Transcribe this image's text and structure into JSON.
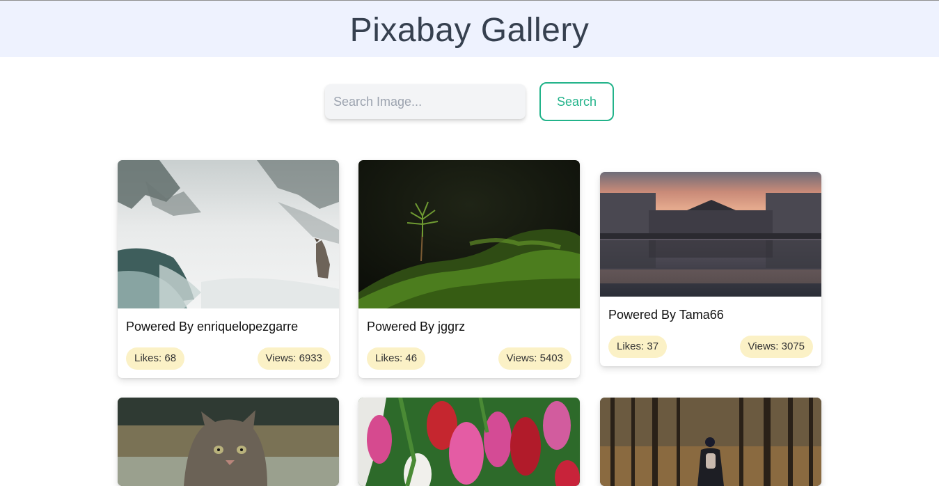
{
  "header": {
    "title": "Pixabay Gallery"
  },
  "search": {
    "placeholder": "Search Image...",
    "value": "",
    "button_label": "Search"
  },
  "cards": [
    {
      "author": "Powered By enriquelopezgarre",
      "likes": "Likes: 68",
      "views": "Views: 6933",
      "image": "foggy-waterfall-wolf"
    },
    {
      "author": "Powered By jggrz",
      "likes": "Likes: 46",
      "views": "Views: 5403",
      "image": "moss-sapling"
    },
    {
      "author": "Powered By Tama66",
      "likes": "Likes: 37",
      "views": "Views: 3075",
      "image": "palace-reflection-sunset"
    },
    {
      "image": "cat-in-grass"
    },
    {
      "image": "pink-red-tulips"
    },
    {
      "image": "hiker-in-forest"
    }
  ],
  "colors": {
    "header_bg": "#eef2fe",
    "title_text": "#36404f",
    "accent": "#22b38a",
    "pill_bg": "#fbf1c6",
    "input_bg": "#f3f4f6"
  }
}
